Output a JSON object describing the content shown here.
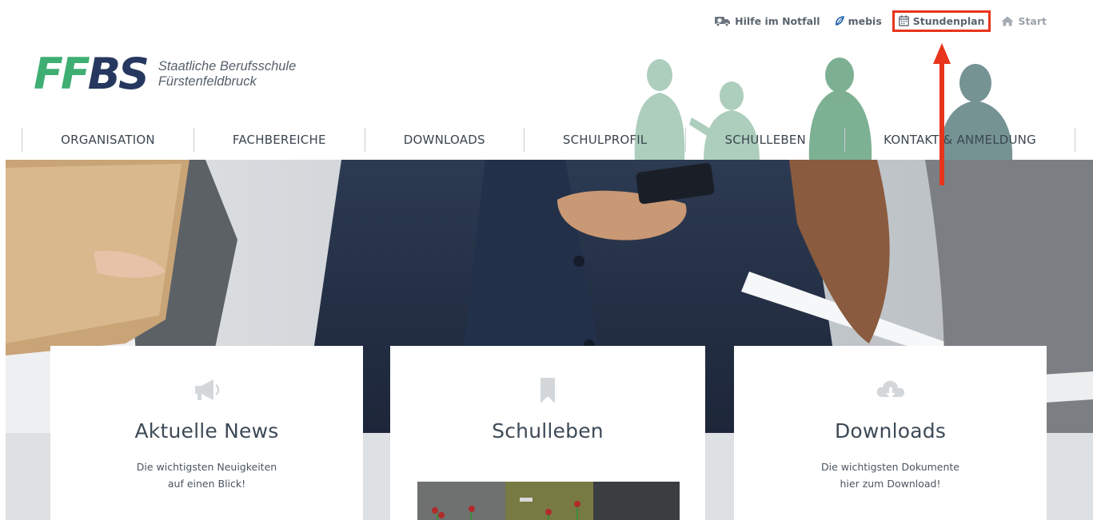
{
  "topbar": {
    "items": [
      {
        "label": "Hilfe im Notfall",
        "icon": "ambulance-icon"
      },
      {
        "label": "mebis",
        "icon": "mebis-logo-icon"
      },
      {
        "label": "Stundenplan",
        "icon": "calendar-icon",
        "highlighted": true
      },
      {
        "label": "Start",
        "icon": "home-icon"
      }
    ]
  },
  "logo": {
    "mark_green": "FF",
    "mark_blue": "BS",
    "line1": "Staatliche Berufsschule",
    "line2": "Fürstenfeldbruck"
  },
  "nav": {
    "items": [
      "ORGANISATION",
      "FACHBEREICHE",
      "DOWNLOADS",
      "SCHULPROFIL",
      "SCHULLEBEN",
      "KONTAKT & ANMELDUNG"
    ]
  },
  "cards": {
    "news": {
      "title": "Aktuelle News",
      "desc_line1": "Die wichtigsten Neuigkeiten",
      "desc_line2": "auf einen Blick!",
      "icon": "megaphone-icon"
    },
    "schulleben": {
      "title": "Schulleben",
      "icon": "bookmark-icon"
    },
    "downloads": {
      "title": "Downloads",
      "desc_line1": "Die wichtigsten Dokumente",
      "desc_line2": "hier zum Download!",
      "icon": "cloud-download-icon"
    }
  },
  "colors": {
    "brand_green": "#3fae73",
    "brand_blue": "#26385f",
    "highlight": "#e8341c",
    "nav_text": "#3b4650"
  }
}
